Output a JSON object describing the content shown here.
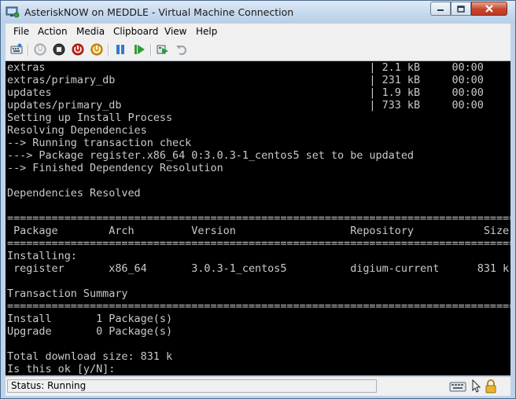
{
  "window": {
    "title": "AsteriskNOW on MEDDLE - Virtual Machine Connection"
  },
  "menu": {
    "items": [
      {
        "label": "File"
      },
      {
        "label": "Action"
      },
      {
        "label": "Media"
      },
      {
        "label": "Clipboard"
      },
      {
        "label": "View"
      },
      {
        "label": "Help"
      }
    ]
  },
  "toolbar": {
    "buttons": [
      {
        "icon": "ctrl-alt-del-icon"
      },
      {
        "icon": "start-icon"
      },
      {
        "icon": "turn-off-icon"
      },
      {
        "icon": "shut-down-icon"
      },
      {
        "icon": "power-icon"
      },
      {
        "icon": "pause-icon"
      },
      {
        "icon": "resume-icon"
      },
      {
        "icon": "snapshot-icon"
      },
      {
        "icon": "revert-icon"
      }
    ]
  },
  "console": {
    "lines": [
      "extras                                                   | 2.1 kB     00:00",
      "extras/primary_db                                        | 231 kB     00:00",
      "updates                                                  | 1.9 kB     00:00",
      "updates/primary_db                                       | 733 kB     00:00",
      "Setting up Install Process",
      "Resolving Dependencies",
      "--> Running transaction check",
      "---> Package register.x86_64 0:3.0.3-1_centos5 set to be updated",
      "--> Finished Dependency Resolution",
      "",
      "Dependencies Resolved",
      "",
      "================================================================================",
      " Package        Arch         Version                  Repository           Size",
      "================================================================================",
      "Installing:",
      " register       x86_64       3.0.3-1_centos5          digium-current      831 k",
      "",
      "Transaction Summary",
      "================================================================================",
      "Install       1 Package(s)",
      "Upgrade       0 Package(s)",
      "",
      "Total download size: 831 k",
      "Is this ok [y/N]:"
    ]
  },
  "status": {
    "text": "Status: Running"
  }
}
